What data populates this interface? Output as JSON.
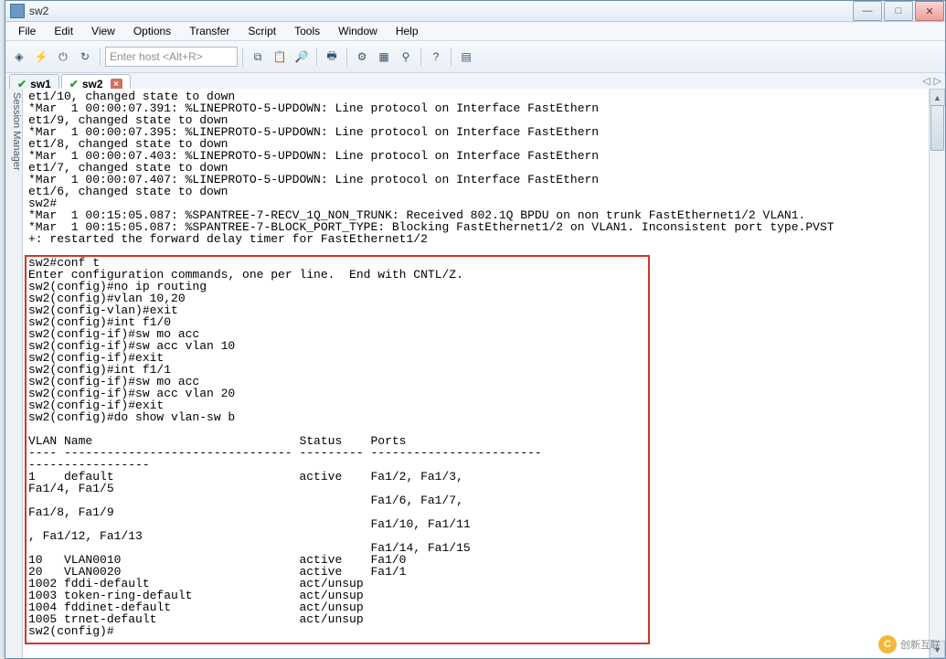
{
  "window": {
    "title": "sw2"
  },
  "menu": {
    "file": "File",
    "edit": "Edit",
    "view": "View",
    "options": "Options",
    "transfer": "Transfer",
    "script": "Script",
    "tools": "Tools",
    "window": "Window",
    "help": "Help"
  },
  "toolbar": {
    "host_placeholder": "Enter host <Alt+R>"
  },
  "tabs": {
    "sw1": "sw1",
    "sw2": "sw2"
  },
  "sidebar": {
    "label": "Session Manager"
  },
  "watermark": {
    "text": "创新互联"
  },
  "terminal": {
    "pre_lines": [
      "et1/10, changed state to down",
      "*Mar  1 00:00:07.391: %LINEPROTO-5-UPDOWN: Line protocol on Interface FastEthern",
      "et1/9, changed state to down",
      "*Mar  1 00:00:07.395: %LINEPROTO-5-UPDOWN: Line protocol on Interface FastEthern",
      "et1/8, changed state to down",
      "*Mar  1 00:00:07.403: %LINEPROTO-5-UPDOWN: Line protocol on Interface FastEthern",
      "et1/7, changed state to down",
      "*Mar  1 00:00:07.407: %LINEPROTO-5-UPDOWN: Line protocol on Interface FastEthern",
      "et1/6, changed state to down",
      "sw2#",
      "*Mar  1 00:15:05.087: %SPANTREE-7-RECV_1Q_NON_TRUNK: Received 802.1Q BPDU on non trunk FastEthernet1/2 VLAN1.",
      "*Mar  1 00:15:05.087: %SPANTREE-7-BLOCK_PORT_TYPE: Blocking FastEthernet1/2 on VLAN1. Inconsistent port type.PVST",
      "+: restarted the forward delay timer for FastEthernet1/2"
    ],
    "box_lines": [
      "sw2#conf t",
      "Enter configuration commands, one per line.  End with CNTL/Z.",
      "sw2(config)#no ip routing",
      "sw2(config)#vlan 10,20",
      "sw2(config-vlan)#exit",
      "sw2(config)#int f1/0",
      "sw2(config-if)#sw mo acc",
      "sw2(config-if)#sw acc vlan 10",
      "sw2(config-if)#exit",
      "sw2(config)#int f1/1",
      "sw2(config-if)#sw mo acc",
      "sw2(config-if)#sw acc vlan 20",
      "sw2(config-if)#exit",
      "sw2(config)#do show vlan-sw b",
      "",
      "VLAN Name                             Status    Ports",
      "---- -------------------------------- --------- ------------------------",
      "-----------------",
      "1    default                          active    Fa1/2, Fa1/3,",
      "Fa1/4, Fa1/5",
      "                                                Fa1/6, Fa1/7,",
      "Fa1/8, Fa1/9",
      "                                                Fa1/10, Fa1/11",
      ", Fa1/12, Fa1/13",
      "                                                Fa1/14, Fa1/15",
      "10   VLAN0010                         active    Fa1/0",
      "20   VLAN0020                         active    Fa1/1",
      "1002 fddi-default                     act/unsup",
      "1003 token-ring-default               act/unsup",
      "1004 fddinet-default                  act/unsup",
      "1005 trnet-default                    act/unsup",
      "sw2(config)#"
    ]
  }
}
